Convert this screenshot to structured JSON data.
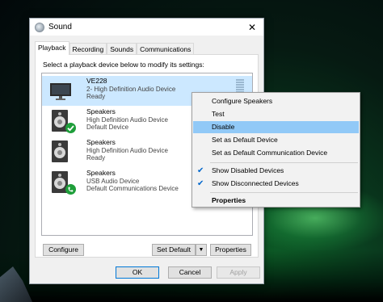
{
  "window": {
    "title": "Sound",
    "close_glyph": "✕"
  },
  "tabs": [
    {
      "label": "Playback",
      "active": true
    },
    {
      "label": "Recording",
      "active": false
    },
    {
      "label": "Sounds",
      "active": false
    },
    {
      "label": "Communications",
      "active": false
    }
  ],
  "instruction": "Select a playback device below to modify its settings:",
  "devices": [
    {
      "name": "VE228",
      "line2": "2- High Definition Audio Device",
      "line3": "Ready",
      "icon": "monitor-icon",
      "status": "",
      "selected": true
    },
    {
      "name": "Speakers",
      "line2": "High Definition Audio Device",
      "line3": "Default Device",
      "icon": "speaker-icon",
      "status": "default-check",
      "selected": false
    },
    {
      "name": "Speakers",
      "line2": "High Definition Audio Device",
      "line3": "Ready",
      "icon": "speaker-icon",
      "status": "",
      "selected": false
    },
    {
      "name": "Speakers",
      "line2": "USB Audio Device",
      "line3": "Default Communications Device",
      "icon": "speaker-icon",
      "status": "comm-phone",
      "selected": false
    }
  ],
  "buttons": {
    "configure": "Configure",
    "set_default": "Set Default",
    "properties": "Properties",
    "ok": "OK",
    "cancel": "Cancel",
    "apply": "Apply"
  },
  "context_menu": [
    {
      "label": "Configure Speakers",
      "checked": false,
      "highlighted": false,
      "bold": false
    },
    {
      "label": "Test",
      "checked": false,
      "highlighted": false,
      "bold": false
    },
    {
      "label": "Disable",
      "checked": false,
      "highlighted": true,
      "bold": false
    },
    {
      "label": "Set as Default Device",
      "checked": false,
      "highlighted": false,
      "bold": false
    },
    {
      "label": "Set as Default Communication Device",
      "checked": false,
      "highlighted": false,
      "bold": false
    },
    {
      "label": "Show Disabled Devices",
      "checked": true,
      "highlighted": false,
      "bold": false
    },
    {
      "label": "Show Disconnected Devices",
      "checked": true,
      "highlighted": false,
      "bold": false
    },
    {
      "label": "Properties",
      "checked": false,
      "highlighted": false,
      "bold": true
    }
  ],
  "colors": {
    "accent": "#0078d7",
    "selection": "#cce8ff",
    "menu_highlight": "#91c9f7",
    "check_badge": "#1e9e3a"
  }
}
